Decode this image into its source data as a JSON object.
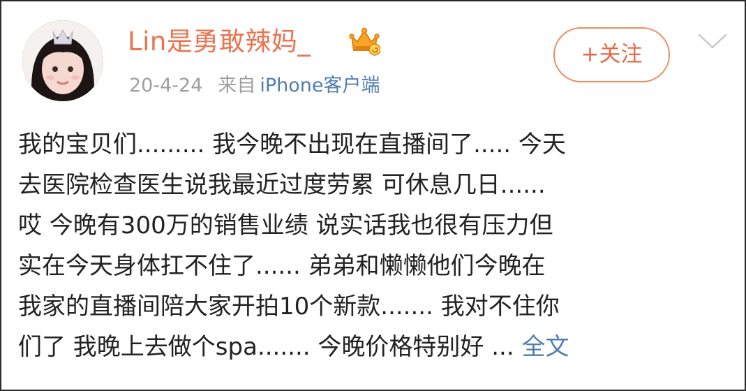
{
  "post": {
    "username": "Lin是勇敢辣妈_",
    "date": "20-4-24",
    "source_prefix": "来自",
    "source_link": "iPhone客户端",
    "follow_label": "+关注",
    "content_lines": [
      "我的宝贝们......... 我今晚不出现在直播间了..... 今天",
      "去医院检查医生说我最近过度劳累 可休息几日......",
      "哎 今晚有300万的销售业绩 说实话我也很有压力但",
      "实在今天身体扛不住了...... 弟弟和懒懒他们今晚在",
      "我家的直播间陪大家开拍10个新款....... 我对不住你",
      "们了 我晚上去做个spa....... 今晚价格特别好 ..."
    ],
    "full_text_label": "全文"
  },
  "colors": {
    "username": "#eb7350",
    "link": "#507daf",
    "meta": "#9e9e9e",
    "text": "#222222",
    "follow_border": "#f08a60"
  },
  "icons": {
    "avatar": "user-avatar",
    "badge": "vip-crown-icon",
    "dropdown": "chevron-down-icon"
  }
}
